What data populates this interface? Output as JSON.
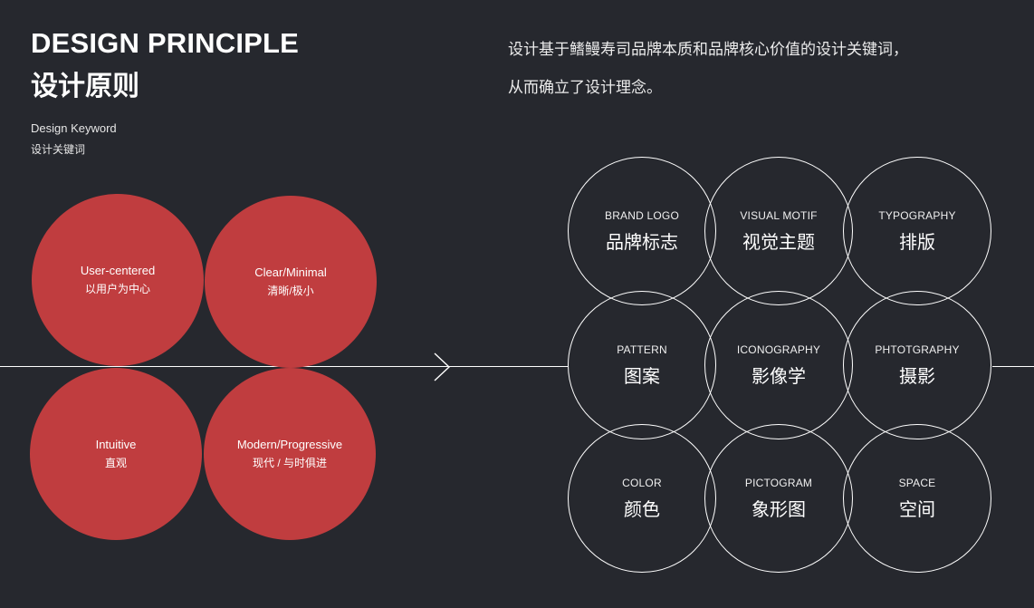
{
  "header": {
    "title_en": "DESIGN PRINCIPLE",
    "title_zh": "设计原则",
    "keyword_en": "Design Keyword",
    "keyword_zh": "设计关键词"
  },
  "description": {
    "line1": "设计基于鳍鳗寿司品牌本质和品牌核心价值的设计关键词，",
    "line2": "从而确立了设计理念。"
  },
  "principles": [
    {
      "en": "User-centered",
      "zh": "以用户为中心"
    },
    {
      "en": "Clear/Minimal",
      "zh": "清晰/极小"
    },
    {
      "en": "Intuitive",
      "zh": "直观"
    },
    {
      "en": "Modern/Progressive",
      "zh": "现代 / 与时俱进"
    }
  ],
  "keywords": [
    {
      "en": "BRAND LOGO",
      "zh": "品牌标志"
    },
    {
      "en": "VISUAL MOTIF",
      "zh": "视觉主题"
    },
    {
      "en": "TYPOGRAPHY",
      "zh": "排版"
    },
    {
      "en": "PATTERN",
      "zh": "图案"
    },
    {
      "en": "ICONOGRAPHY",
      "zh": "影像学"
    },
    {
      "en": "PHTOTGRAPHY",
      "zh": "摄影"
    },
    {
      "en": "COLOR",
      "zh": "颜色"
    },
    {
      "en": "PICTOGRAM",
      "zh": "象形图"
    },
    {
      "en": "SPACE",
      "zh": "空间"
    }
  ],
  "colors": {
    "background": "#26282e",
    "accent_red": "#c03d3f",
    "line": "#ffffff"
  },
  "icons": {
    "arrow": "chevron-right-icon"
  }
}
